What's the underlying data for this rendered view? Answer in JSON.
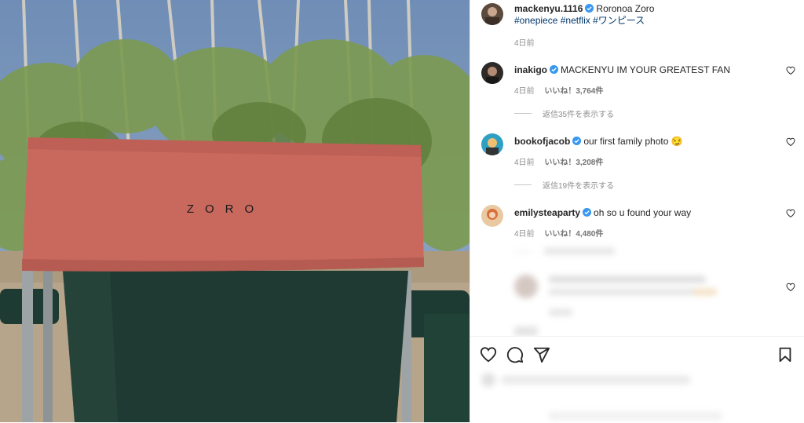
{
  "photo": {
    "alt_text": "ZORO",
    "colors": {
      "chair_cloth": "#c9695e",
      "chair_seat": "#1f3a32",
      "sky": "#6d86a8",
      "foliage": "#7c9a50"
    }
  },
  "caption": {
    "username": "mackenyu.1116",
    "text": "Roronoa Zoro",
    "hashtags": "#onepiece #netflix #ワンピース",
    "time": "4日前"
  },
  "comments": [
    {
      "username": "inakigo",
      "text": "MACKENYU IM YOUR GREATEST FAN",
      "time": "4日前",
      "likes": "いいね！3,764件",
      "replies": "返信35件を表示する"
    },
    {
      "username": "bookofjacob",
      "text": "our first family photo 😏",
      "time": "4日前",
      "likes": "いいね！3,208件",
      "replies": "返信19件を表示する"
    },
    {
      "username": "emilysteaparty",
      "text": "oh so u found your way",
      "time": "4日前",
      "likes": "いいね！4,480件",
      "replies": ""
    }
  ],
  "icons": {
    "verified": "verified-badge-icon",
    "like": "heart-icon",
    "comment": "comment-icon",
    "share": "share-icon",
    "save": "bookmark-icon"
  },
  "accent_color": "#3897f0"
}
